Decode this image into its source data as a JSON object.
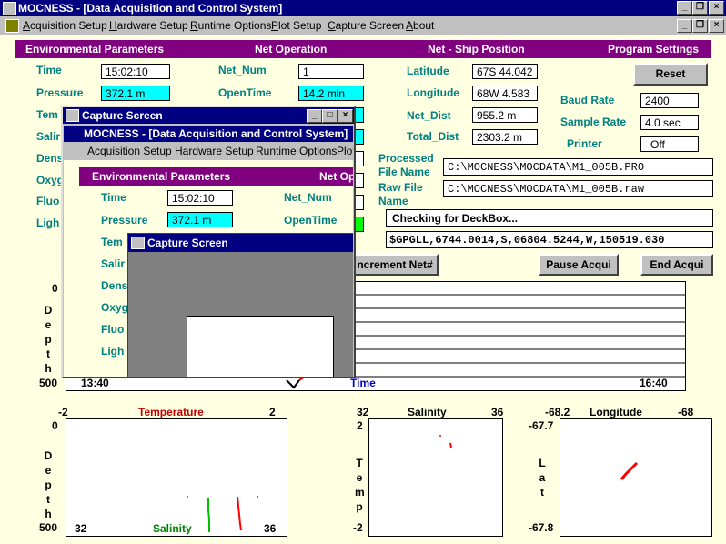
{
  "app": {
    "title": "MOCNESS - [Data Acquisition and Control System]",
    "menu": [
      "Acquisition Setup",
      "Hardware Setup",
      "Runtime Options",
      "Plot Setup",
      "Capture Screen",
      "About"
    ]
  },
  "headers": {
    "env": "Environmental Parameters",
    "net_op": "Net Operation",
    "net_ship": "Net - Ship Position",
    "program": "Program Settings"
  },
  "env": {
    "time_label": "Time",
    "time_value": "15:02:10",
    "pressure_label": "Pressure",
    "pressure_value": "372.1 m",
    "temp_label": "Tem",
    "salinity_label": "Salir",
    "density_label": "Dens",
    "oxygen_label": "Oxyg",
    "fluoro_label": "Fluo",
    "light_label": "Ligh"
  },
  "netop": {
    "netnum_label": "Net_Num",
    "netnum_value": "1",
    "opentime_label": "OpenTime",
    "opentime_value": "14.2 min"
  },
  "position": {
    "lat_label": "Latitude",
    "lat_value": "67S 44.042",
    "lon_label": "Longitude",
    "lon_value": "68W 4.583",
    "netdist_label": "Net_Dist",
    "netdist_value": "955.2 m",
    "totaldist_label": "Total_Dist",
    "totaldist_value": "2303.2 m"
  },
  "settings": {
    "reset_label": "Reset",
    "baud_label": "Baud Rate",
    "baud_value": "2400",
    "sample_label": "Sample Rate",
    "sample_value": "4.0 sec",
    "printer_label": "Printer",
    "printer_value": "Off"
  },
  "files": {
    "processed_label_1": "Processed",
    "processed_label_2": "File Name",
    "processed_value": "C:\\MOCNESS\\MOCDATA\\M1_005B.PRO",
    "raw_label_1": "Raw File",
    "raw_label_2": "Name",
    "raw_value": "C:\\MOCNESS\\MOCDATA\\M1_005B.raw"
  },
  "status": {
    "message": "Checking for DeckBox...",
    "gps": "$GPGLL,6744.0014,S,06804.5244,W,150519.030"
  },
  "buttons": {
    "increment": "ncrement Net#",
    "pause": "Pause Acqui",
    "end": "End Acqui"
  },
  "time_plot": {
    "y_top": "0",
    "y_bottom": "500",
    "x_start": "13:40",
    "x_label": "Time",
    "x_end": "16:40",
    "ylabel_letters": [
      "D",
      "e",
      "p",
      "t",
      "h"
    ]
  },
  "temp_plot": {
    "top_left": "-2",
    "top_label": "Temperature",
    "top_right": "2",
    "y_top": "0",
    "y_bottom": "500",
    "bottom_left": "32",
    "bottom_label": "Salinity",
    "bottom_right": "36",
    "ylabel_letters": [
      "D",
      "e",
      "p",
      "t",
      "h"
    ],
    "colors": {
      "temperature": "#ff0000",
      "salinity": "#00c000"
    }
  },
  "ts_plot": {
    "top_left": "32",
    "top_label": "Salinity",
    "top_right": "36",
    "y_top": "2",
    "y_bottom": "-2",
    "ylabel_letters": [
      "T",
      "e",
      "m",
      "p"
    ]
  },
  "track_plot": {
    "top_left": "-68.2",
    "top_label": "Longitude",
    "top_right": "-68",
    "y_top": "-67.7",
    "y_bottom": "-67.8",
    "ylabel_letters": [
      "L",
      "a",
      "t"
    ]
  },
  "capture_window": {
    "title": "Capture Screen",
    "inner_title": "MOCNESS - [Data Acquisition and Control System]",
    "inner_menu": [
      "Acquisition Setup",
      "Hardware Setup",
      "Runtime Options",
      "Plot"
    ],
    "inner_env_header": "Environmental Parameters",
    "inner_netop_header": "Net Op",
    "nested_title": "Capture Screen"
  }
}
